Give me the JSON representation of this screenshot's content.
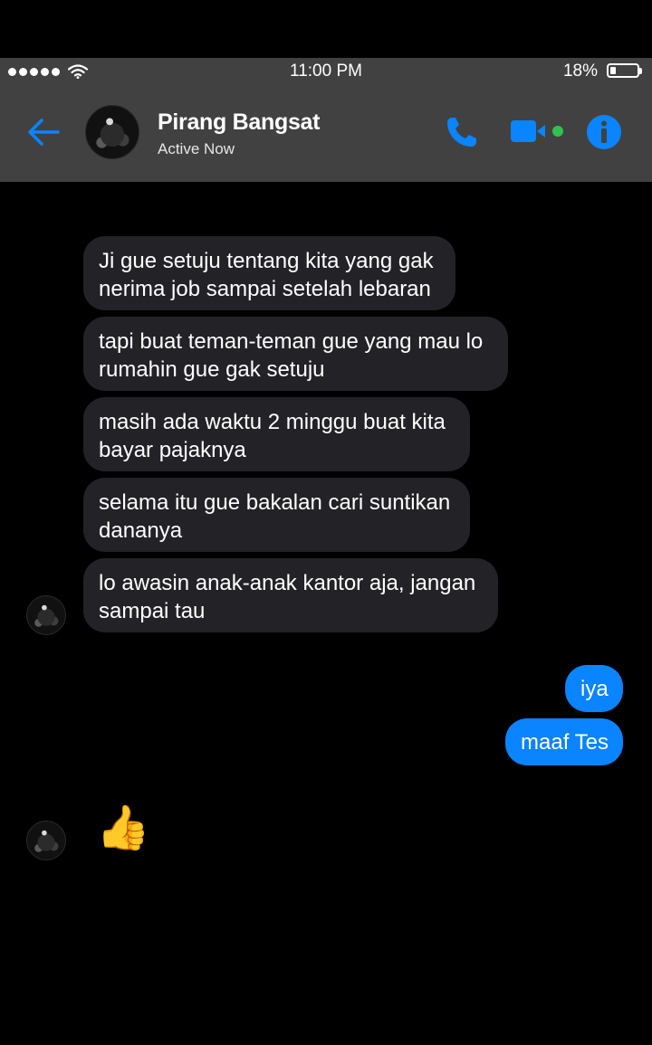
{
  "status_bar": {
    "time": "11:00 PM",
    "battery": "18%"
  },
  "header": {
    "contact_name": "Pirang Bangsat",
    "contact_status": "Active Now"
  },
  "messages": [
    {
      "sender": "them",
      "text": "Ji gue setuju tentang kita yang gak nerima job sampai setelah lebaran"
    },
    {
      "sender": "them",
      "text": "tapi buat teman-teman gue yang mau lo rumahin gue gak setuju"
    },
    {
      "sender": "them",
      "text": "masih ada waktu 2 minggu buat kita bayar pajaknya"
    },
    {
      "sender": "them",
      "text": "selama itu gue bakalan cari suntikan dananya"
    },
    {
      "sender": "them",
      "text": "lo awasin anak-anak kantor aja, jangan sampai tau"
    },
    {
      "sender": "me",
      "text": "iya"
    },
    {
      "sender": "me",
      "text": "maaf Tes"
    },
    {
      "sender": "them",
      "text": "👍"
    }
  ],
  "colors": {
    "accent": "#0a84ff",
    "header_bg": "#414141",
    "incoming_bubble": "#232226",
    "online_dot": "#31c24d"
  },
  "icons": {
    "back": "back-arrow-icon",
    "call": "phone-icon",
    "video": "video-camera-icon",
    "info": "info-icon",
    "signal": "signal-dots-icon",
    "wifi": "wifi-icon",
    "battery": "battery-icon"
  }
}
